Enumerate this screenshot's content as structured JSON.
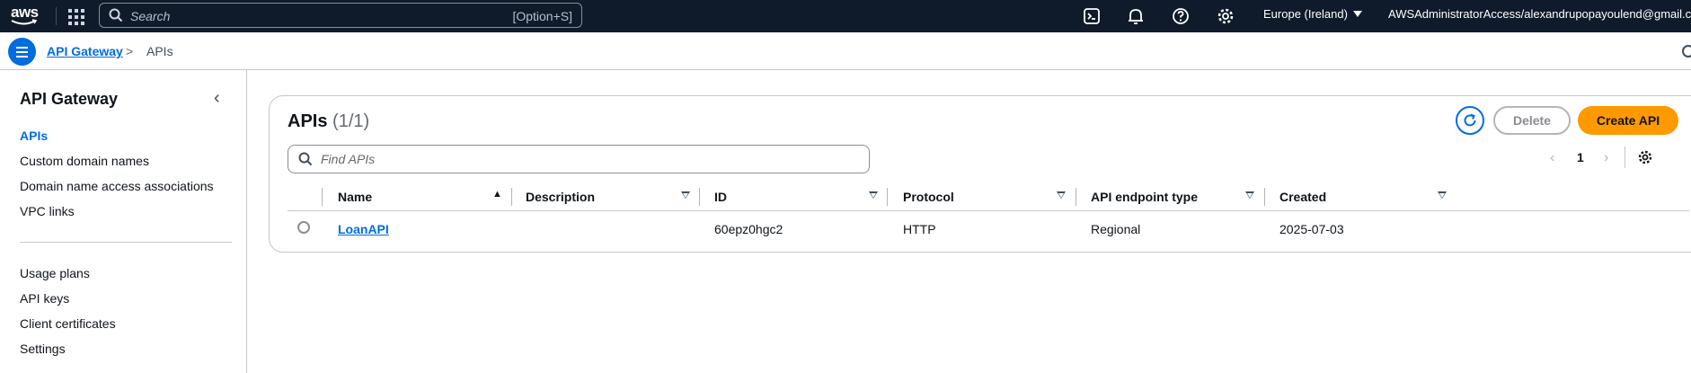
{
  "topnav": {
    "logo_text": "aws",
    "search_placeholder": "Search",
    "search_shortcut": "[Option+S]",
    "region": "Europe (Ireland)",
    "account": "AWSAdministratorAccess/alexandrupopayoulend@gmail.com",
    "icons": [
      "cloudshell-icon",
      "notifications-icon",
      "help-icon",
      "settings-icon"
    ]
  },
  "breadcrumb": {
    "items": [
      "API Gateway",
      "APIs"
    ],
    "separator": ">"
  },
  "sidebar": {
    "title": "API Gateway",
    "collapse_glyph": "‹",
    "group1": [
      "APIs",
      "Custom domain names",
      "Domain name access associations",
      "VPC links"
    ],
    "group2": [
      "Usage plans",
      "API keys",
      "Client certificates",
      "Settings"
    ],
    "active": "APIs"
  },
  "panel": {
    "title": "APIs",
    "count": "(1/1)",
    "delete_label": "Delete",
    "create_label": "Create API",
    "find_placeholder": "Find APIs",
    "page": "1"
  },
  "table": {
    "columns": [
      "Name",
      "Description",
      "ID",
      "Protocol",
      "API endpoint type",
      "Created"
    ],
    "rows": [
      {
        "name": "LoanAPI",
        "description": "",
        "id": "60epz0hgc2",
        "protocol": "HTTP",
        "endpoint_type": "Regional",
        "created": "2025-07-03"
      }
    ]
  },
  "colors": {
    "nav_bg": "#0f1b2a",
    "accent_blue": "#006ce0",
    "primary_orange": "#ff9900"
  }
}
